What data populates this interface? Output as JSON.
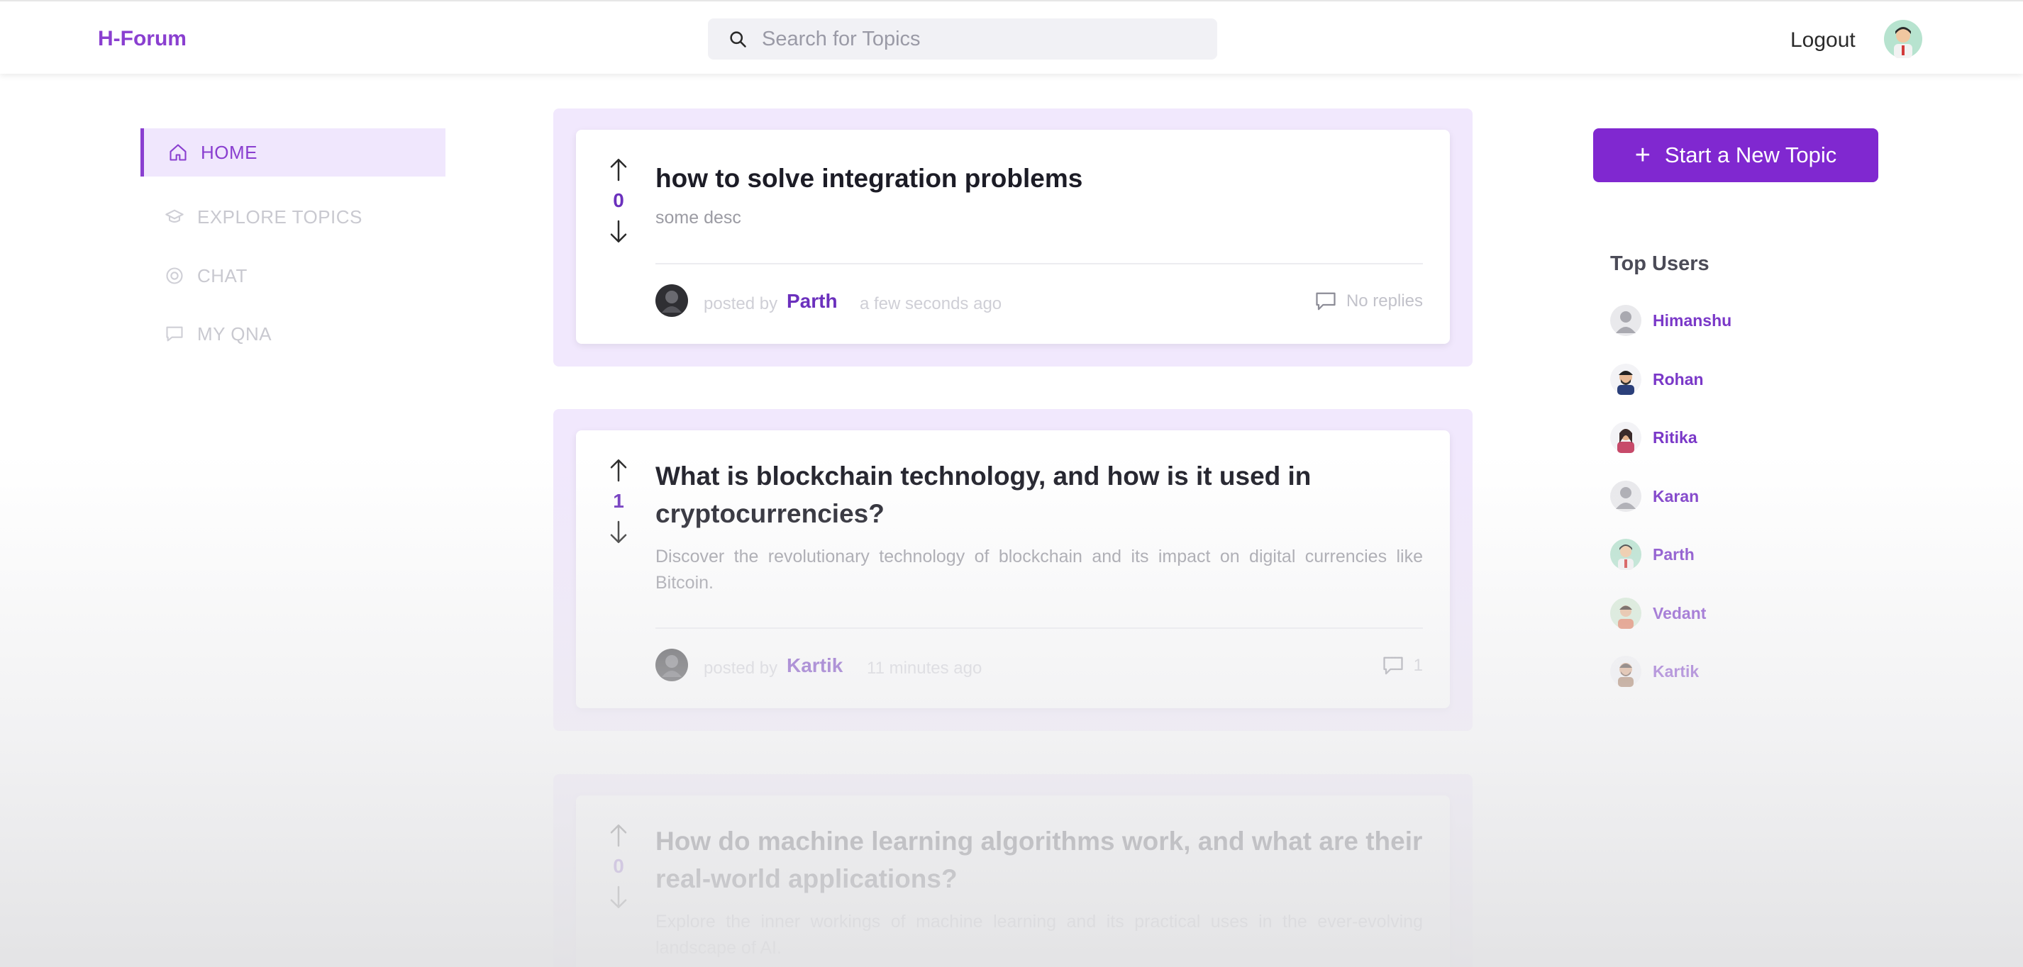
{
  "header": {
    "brand": "H-Forum",
    "search_placeholder": "Search for Topics",
    "logout_label": "Logout",
    "avatar_icon": "user-avatar-icon"
  },
  "sidebar": {
    "items": [
      {
        "label": "HOME",
        "icon": "home-icon",
        "active": true
      },
      {
        "label": "EXPLORE TOPICS",
        "icon": "graduation-cap-icon",
        "active": false
      },
      {
        "label": "CHAT",
        "icon": "chat-circle-icon",
        "active": false
      },
      {
        "label": "MY QNA",
        "icon": "comment-icon",
        "active": false
      }
    ]
  },
  "posts": [
    {
      "votes": "0",
      "title": "how to solve integration problems",
      "description": "some desc",
      "posted_by_label": "posted by",
      "author": "Parth",
      "time": "a few seconds ago",
      "replies": "No replies"
    },
    {
      "votes": "1",
      "title": "What is blockchain technology, and how is it used in cryptocurrencies?",
      "description": "Discover the revolutionary technology of blockchain and its impact on digital currencies like Bitcoin.",
      "posted_by_label": "posted by",
      "author": "Kartik",
      "time": "11 minutes ago",
      "replies": "1"
    },
    {
      "votes": "0",
      "title": "How do machine learning algorithms work, and what are their real-world applications?",
      "description": "Explore the inner workings of machine learning and its practical uses in the ever-evolving landscape of AI."
    }
  ],
  "right_panel": {
    "new_topic_label": "Start a New Topic",
    "top_users_title": "Top Users",
    "users": [
      "Himanshu",
      "Rohan",
      "Ritika",
      "Karan",
      "Parth",
      "Vedant",
      "Kartik"
    ]
  },
  "colors": {
    "accent": "#8028d0",
    "accent_light": "#f1e8fd",
    "vote_count": "#6b30bd"
  }
}
